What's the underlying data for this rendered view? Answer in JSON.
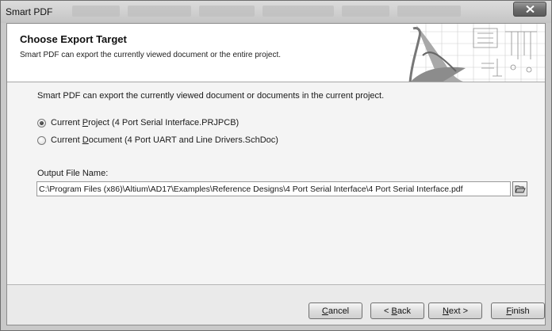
{
  "window": {
    "title": "Smart PDF"
  },
  "header": {
    "title": "Choose Export Target",
    "subtitle": "Smart PDF can export the currently viewed document or the entire project."
  },
  "body": {
    "intro": "Smart PDF can export the currently viewed document or documents in the current project.",
    "options": [
      {
        "prefix": "Current ",
        "accel": "P",
        "rest": "roject (4 Port Serial Interface.PRJPCB)",
        "checked": true
      },
      {
        "prefix": "Current ",
        "accel": "D",
        "rest": "ocument (4 Port UART and Line Drivers.SchDoc)",
        "checked": false
      }
    ],
    "output_label": "Output File Name:",
    "output_value": "C:\\Program Files (x86)\\Altium\\AD17\\Examples\\Reference Designs\\4 Port Serial Interface\\4 Port Serial Interface.pdf"
  },
  "footer": {
    "cancel": {
      "accel": "C",
      "rest": "ancel"
    },
    "back": {
      "pre": "< ",
      "accel": "B",
      "rest": "ack"
    },
    "next": {
      "accel": "N",
      "rest": "ext >"
    },
    "finish": {
      "accel": "F",
      "rest": "inish"
    }
  }
}
